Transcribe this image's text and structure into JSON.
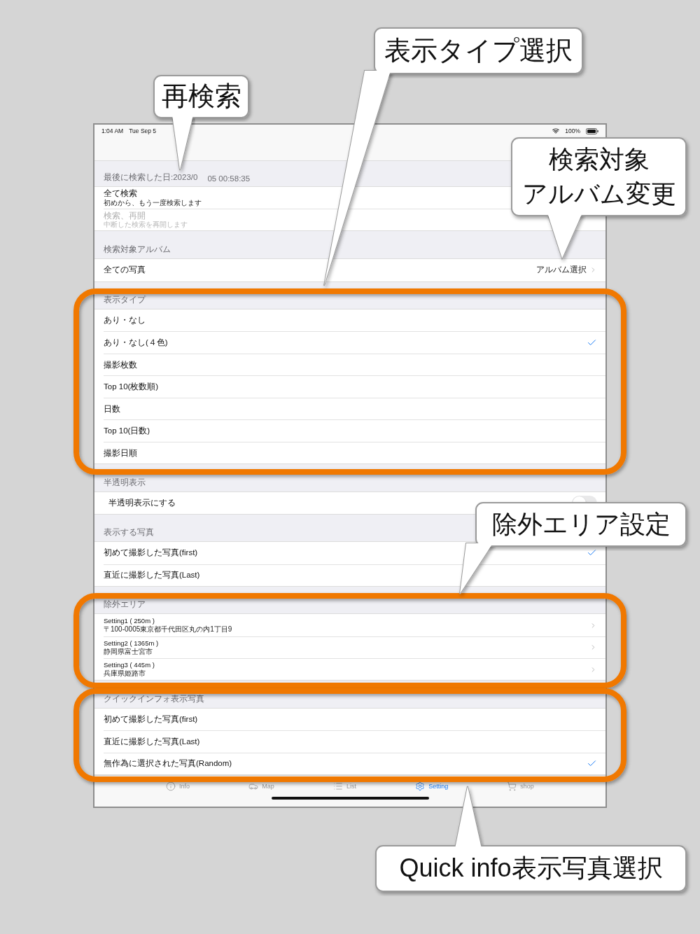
{
  "status_bar": {
    "time": "1:04 AM",
    "date": "Tue Sep 5",
    "battery": "100%"
  },
  "sections": [
    {
      "header": "最後に検索した日:2023/0",
      "header_tail": "05 00:58:35",
      "rows": [
        {
          "kind": "detail",
          "title": "全て検索",
          "subtitle": "初めから、もう一度検索します",
          "disabled": false
        },
        {
          "kind": "detail",
          "title": "検索、再開",
          "subtitle": "中断した検索を再開します",
          "disabled": true
        }
      ]
    },
    {
      "header": "検索対象アルバム",
      "rows": [
        {
          "kind": "value",
          "title": "全ての写真",
          "value": "アルバム選択"
        }
      ]
    },
    {
      "header": "表示タイプ",
      "rows": [
        {
          "kind": "check",
          "title": "あり・なし",
          "selected": false
        },
        {
          "kind": "check",
          "title": "あり・なし(４色)",
          "selected": true
        },
        {
          "kind": "check",
          "title": "撮影枚数",
          "selected": false
        },
        {
          "kind": "check",
          "title": "Top 10(枚数順)",
          "selected": false
        },
        {
          "kind": "check",
          "title": "日数",
          "selected": false
        },
        {
          "kind": "check",
          "title": "Top 10(日数)",
          "selected": false
        },
        {
          "kind": "check",
          "title": "撮影日順",
          "selected": false
        }
      ]
    },
    {
      "header": "半透明表示",
      "rows": [
        {
          "kind": "toggle",
          "title": "半透明表示にする",
          "on": false
        }
      ]
    },
    {
      "header": "表示する写真",
      "rows": [
        {
          "kind": "check",
          "title": "初めて撮影した写真(first)",
          "selected": true
        },
        {
          "kind": "check",
          "title": "直近に撮影した写真(Last)",
          "selected": false
        }
      ]
    },
    {
      "header": "除外エリア",
      "rows": [
        {
          "kind": "nav",
          "title": "Setting1 ( 250m )",
          "subtitle": "〒100-0005東京都千代田区丸の内1丁目9"
        },
        {
          "kind": "nav",
          "title": "Setting2 ( 1365m )",
          "subtitle": "静岡県富士宮市"
        },
        {
          "kind": "nav",
          "title": "Setting3 ( 445m )",
          "subtitle": "兵庫県姫路市"
        }
      ]
    },
    {
      "header": "クイックインフォ表示写真",
      "rows": [
        {
          "kind": "check",
          "title": "初めて撮影した写真(first)",
          "selected": false
        },
        {
          "kind": "check",
          "title": "直近に撮影した写真(Last)",
          "selected": false
        },
        {
          "kind": "check",
          "title": "無作為に選択された写真(Random)",
          "selected": true
        }
      ]
    }
  ],
  "tabs": [
    {
      "label": "Info",
      "selected": false
    },
    {
      "label": "Map",
      "selected": false
    },
    {
      "label": "List",
      "selected": false
    },
    {
      "label": "Setting",
      "selected": true
    },
    {
      "label": "shop",
      "selected": false
    }
  ],
  "annotations": [
    {
      "lines": [
        "再検索"
      ]
    },
    {
      "lines": [
        "表示タイプ選択"
      ]
    },
    {
      "lines": [
        "検索対象",
        "アルバム変更"
      ]
    },
    {
      "lines": [
        "除外エリア設定"
      ]
    },
    {
      "lines": [
        "Quick info表示写真選択"
      ]
    }
  ]
}
